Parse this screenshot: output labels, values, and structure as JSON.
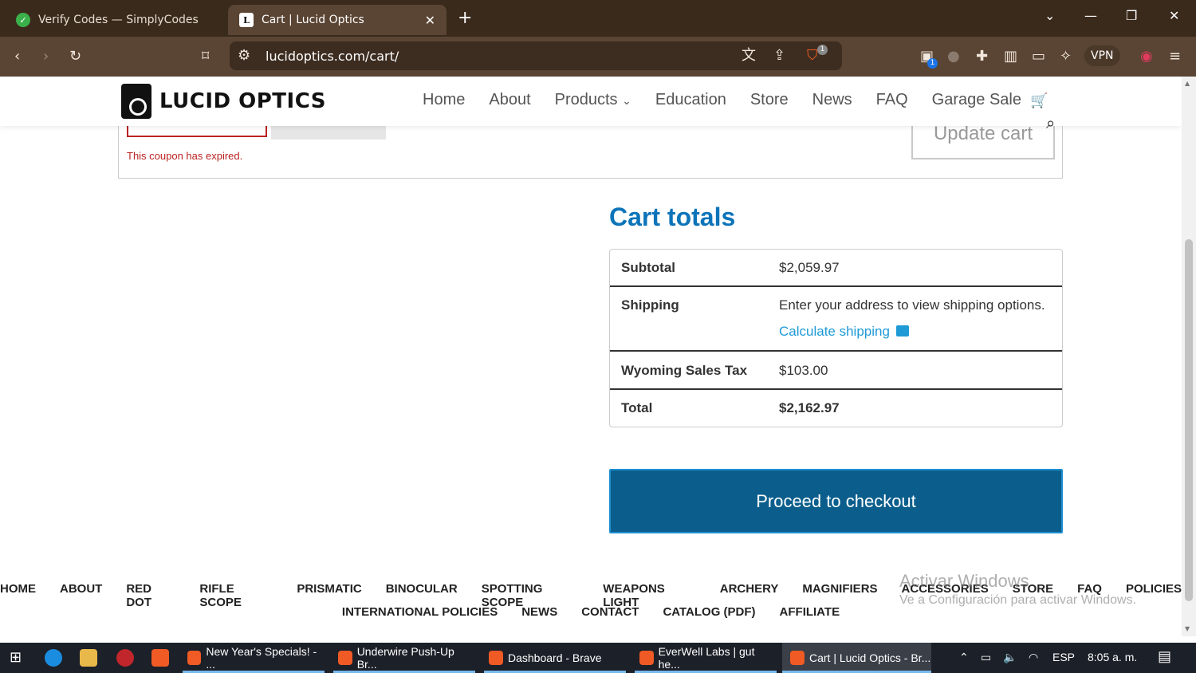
{
  "browser": {
    "tabs": [
      {
        "title": "Verify Codes — SimplyCodes",
        "active": false
      },
      {
        "title": "Cart | Lucid Optics",
        "active": true
      }
    ],
    "url": "lucidoptics.com/cart/",
    "vpn_label": "VPN",
    "shield_badge": "1",
    "ext_badge": "1"
  },
  "site": {
    "logo_text": "LUCID OPTICS",
    "nav": [
      "Home",
      "About",
      "Products",
      "Education",
      "Store",
      "News",
      "FAQ",
      "Garage Sale"
    ]
  },
  "coupon": {
    "message": "This coupon has expired.",
    "update_cart_label": "Update cart"
  },
  "cart_totals": {
    "title": "Cart totals",
    "subtotal_label": "Subtotal",
    "subtotal_value": "$2,059.97",
    "shipping_label": "Shipping",
    "shipping_text": "Enter your address to view shipping options.",
    "calc_shipping_label": "Calculate shipping",
    "tax_label": "Wyoming Sales Tax",
    "tax_value": "$103.00",
    "total_label": "Total",
    "total_value": "$2,162.97"
  },
  "checkout_label": "Proceed to checkout",
  "footer": {
    "line1": [
      "HOME",
      "ABOUT",
      "RED DOT",
      "RIFLE SCOPE",
      "PRISMATIC",
      "BINOCULAR",
      "SPOTTING SCOPE",
      "WEAPONS LIGHT",
      "ARCHERY",
      "MAGNIFIERS",
      "ACCESSORIES",
      "STORE",
      "FAQ",
      "POLICIES"
    ],
    "line2": [
      "INTERNATIONAL POLICIES",
      "NEWS",
      "CONTACT",
      "CATALOG (PDF)",
      "AFFILIATE"
    ]
  },
  "watermark": {
    "line1": "Activar Windows",
    "line2": "Ve a Configuración para activar Windows."
  },
  "taskbar": {
    "apps": [
      {
        "title": "New Year's Specials! - ..."
      },
      {
        "title": "Underwire Push-Up Br..."
      },
      {
        "title": "Dashboard - Brave"
      },
      {
        "title": "EverWell Labs | gut he..."
      },
      {
        "title": "Cart | Lucid Optics - Br..."
      }
    ],
    "language": "ESP",
    "time": "8:05 a. m."
  },
  "colors": {
    "accent_blue": "#0d74b9",
    "checkout_bg": "#0b5e8c",
    "error_red": "#bb2222",
    "link_blue": "#1e9ad6"
  }
}
